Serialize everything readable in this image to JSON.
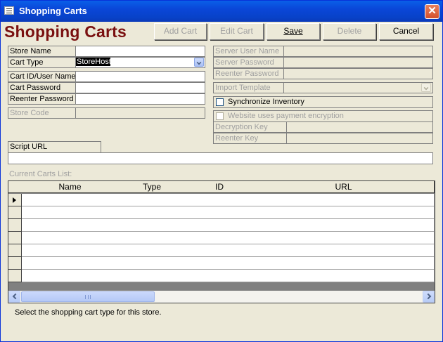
{
  "window": {
    "title": "Shopping Carts",
    "close_glyph": "✕"
  },
  "heading": "Shopping Carts",
  "toolbar": {
    "add_cart": "Add Cart",
    "edit_cart": "Edit Cart",
    "save": "Save",
    "delete": "Delete",
    "cancel": "Cancel"
  },
  "form": {
    "store_name_label": "Store Name",
    "store_name_value": "",
    "cart_type_label": "Cart Type",
    "cart_type_value": "StoreHost",
    "cart_id_label": "Cart ID/User Name",
    "cart_password_label": "Cart Password",
    "reenter_password_label": "Reenter Password",
    "store_code_label": "Store Code",
    "server_user_label": "Server User Name",
    "server_password_label": "Server Password",
    "server_reenter_label": "Reenter Password",
    "import_template_label": "Import Template",
    "sync_inventory_label": "Synchronize Inventory",
    "website_encryption_label": "Website uses payment encryption",
    "decryption_key_label": "Decryption Key",
    "reenter_key_label": "Reenter Key",
    "script_url_label": "Script URL",
    "script_url_value": ""
  },
  "carts_list": {
    "label": "Current Carts List:",
    "columns": [
      "Name",
      "Type",
      "ID",
      "URL"
    ],
    "rows": 7
  },
  "status_text": "Select the shopping cart type for this store."
}
